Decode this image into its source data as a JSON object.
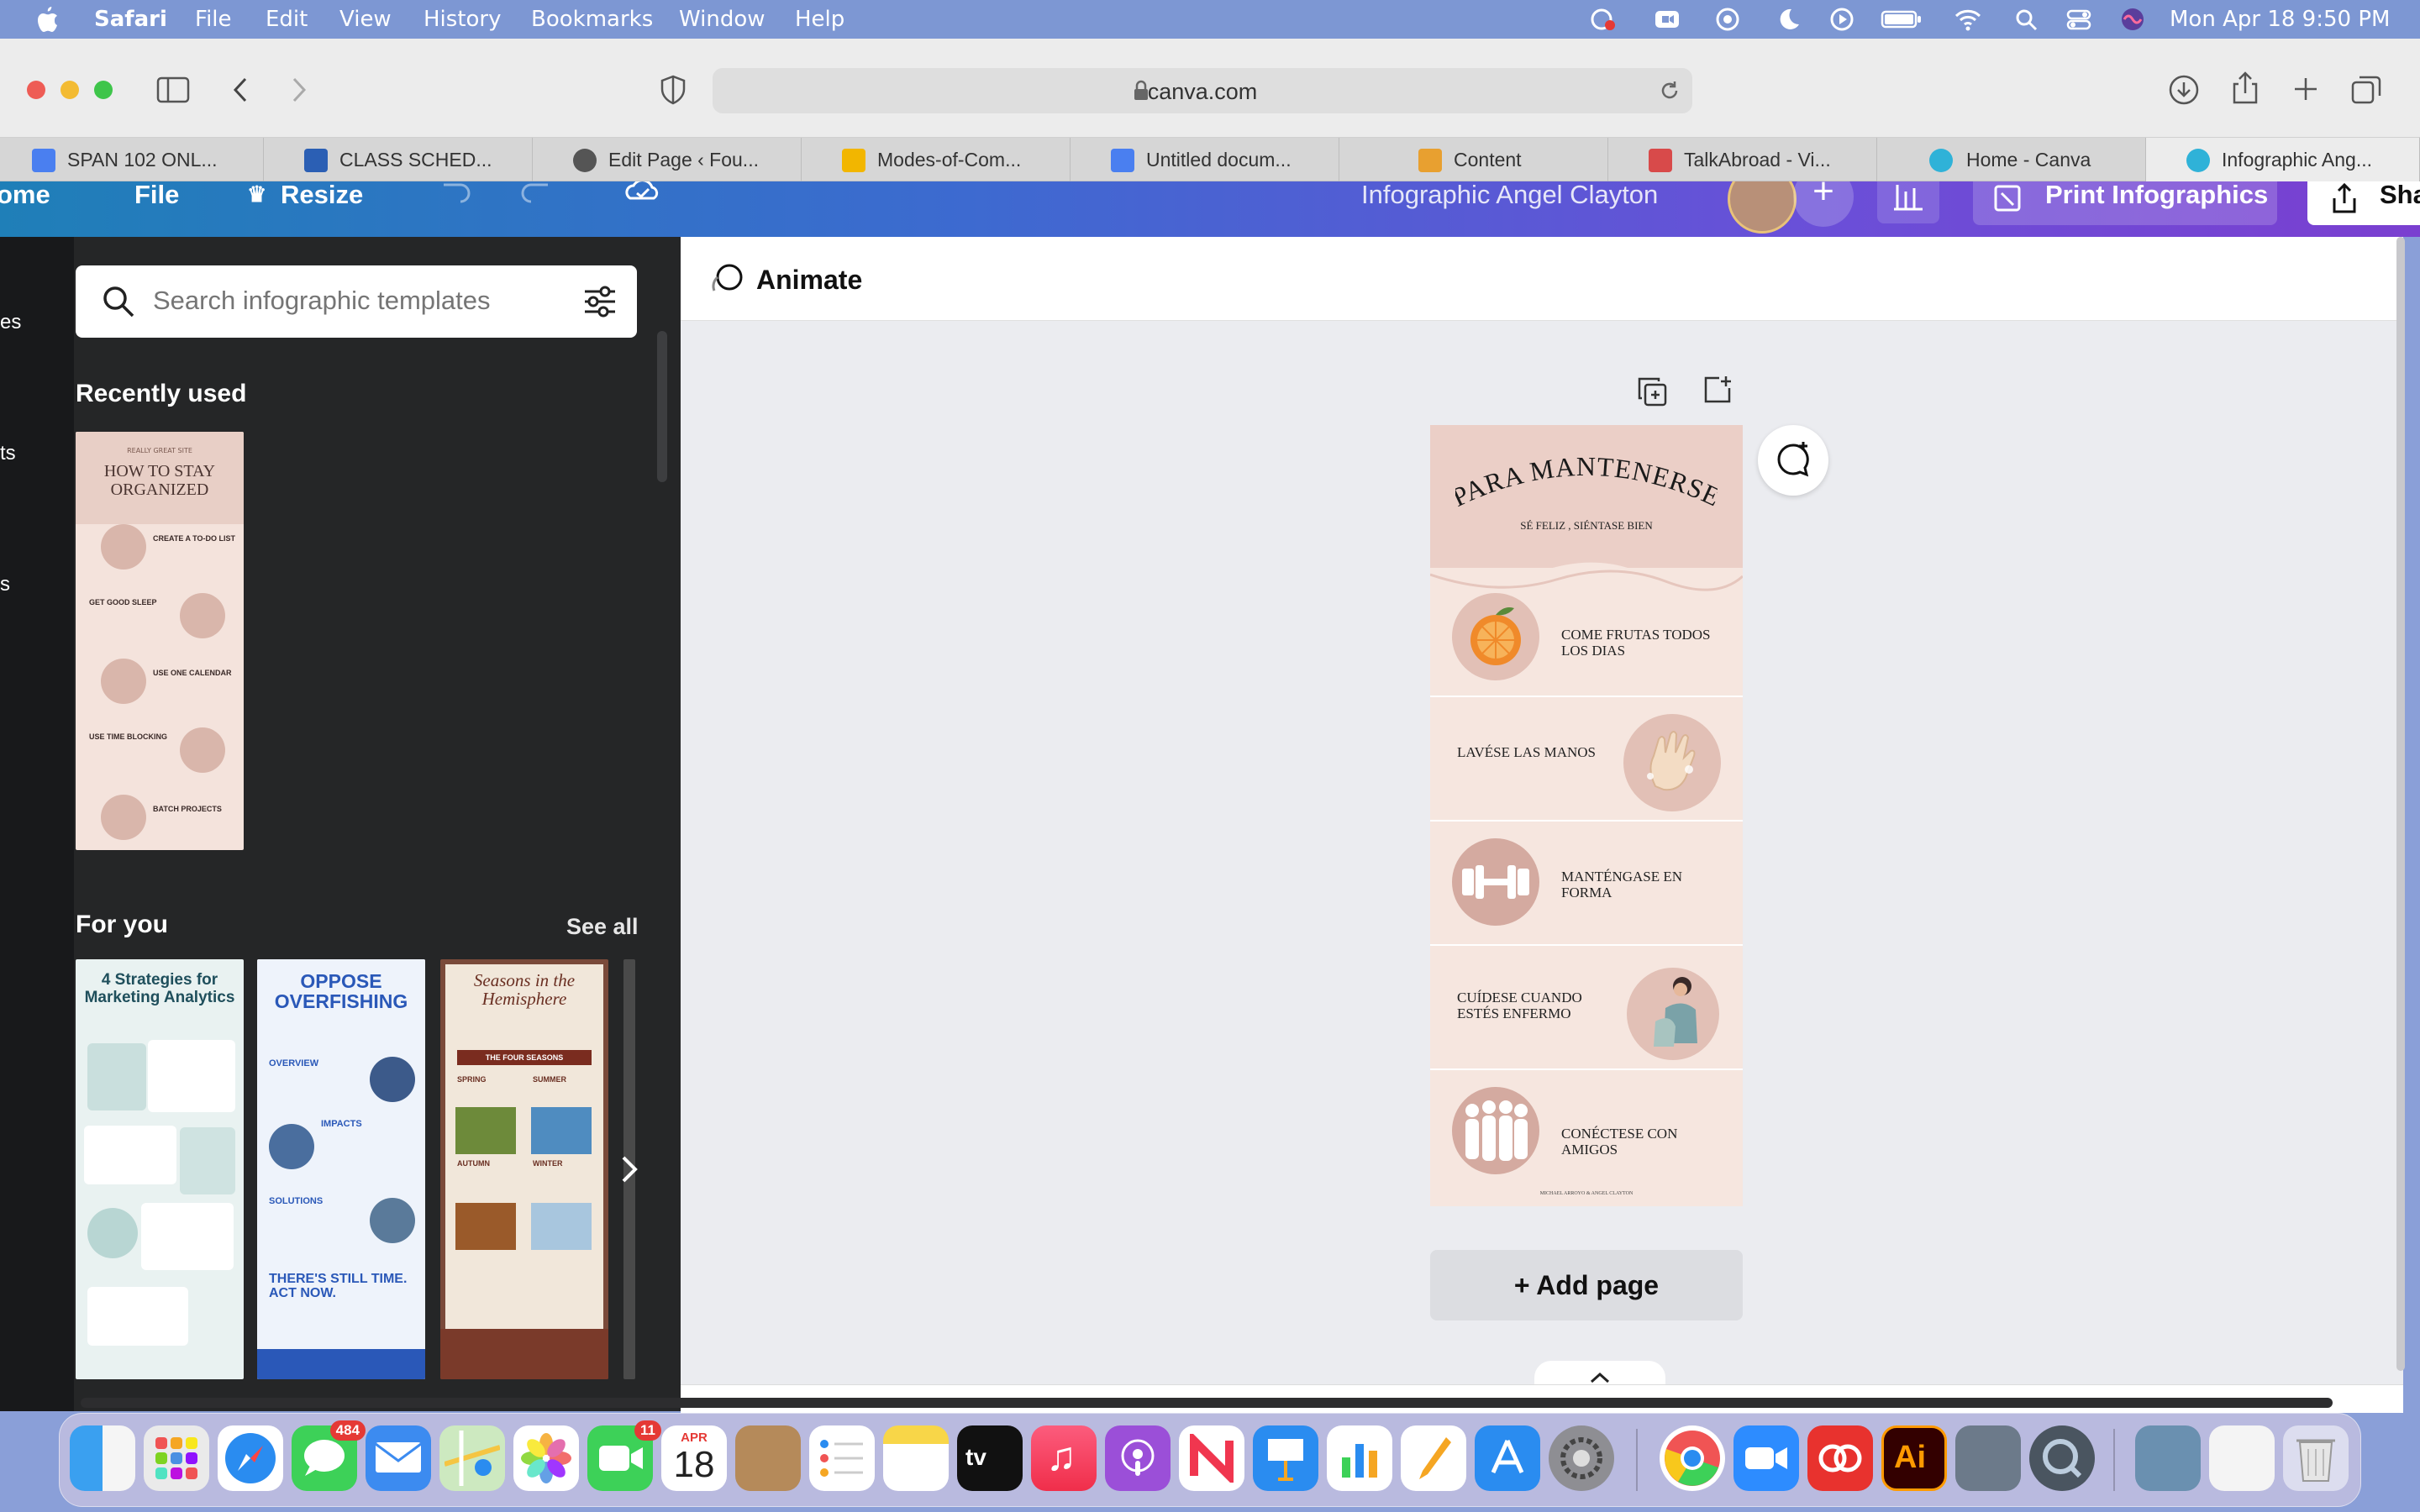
{
  "menubar": {
    "app": "Safari",
    "items": [
      "File",
      "Edit",
      "View",
      "History",
      "Bookmarks",
      "Window",
      "Help"
    ],
    "clock": "Mon Apr 18  9:50 PM"
  },
  "browser": {
    "url": "canva.com",
    "tabs": [
      {
        "label": "SPAN 102 ONL...",
        "color": "#4a7ff0"
      },
      {
        "label": "CLASS SCHED...",
        "color": "#2b5fb4"
      },
      {
        "label": "Edit Page ‹ Fou...",
        "color": "#555555"
      },
      {
        "label": "Modes-of-Com...",
        "color": "#f2b600"
      },
      {
        "label": "Untitled docum...",
        "color": "#4a7ff0"
      },
      {
        "label": "Content",
        "color": "#e8a030"
      },
      {
        "label": "TalkAbroad - Vi...",
        "color": "#d84a4a"
      },
      {
        "label": "Home - Canva",
        "color": "#2fb2d8"
      },
      {
        "label": "Infographic Ang...",
        "color": "#2fb2d8"
      }
    ]
  },
  "canva": {
    "header": {
      "home": "ome",
      "file": "File",
      "resize": "Resize",
      "title": "Infographic Angel Clayton",
      "print": "Print Infographics",
      "share": "Sha"
    },
    "sidebar_partial": [
      "es",
      "ts",
      "s"
    ],
    "search_placeholder": "Search infographic templates",
    "recent_title": "Recently used",
    "foryou_title": "For you",
    "see_all": "See all",
    "recent_template": {
      "kicker": "REALLY GREAT SITE",
      "title": "HOW TO STAY ORGANIZED",
      "items": [
        "CREATE A TO-DO LIST",
        "GET GOOD SLEEP",
        "USE ONE CALENDAR",
        "USE TIME BLOCKING",
        "BATCH PROJECTS"
      ]
    },
    "foryou_templates": [
      {
        "title": "4 Strategies for Marketing Analytics"
      },
      {
        "title": "OPPOSE OVERFISHING",
        "sub1": "OVERVIEW",
        "sub2": "IMPACTS",
        "sub3": "SOLUTIONS",
        "footer": "THERE'S STILL TIME. ACT NOW."
      },
      {
        "title": "Seasons in the Hemisphere",
        "band": "THE FOUR SEASONS",
        "s1": "SPRING",
        "s2": "SUMMER",
        "s3": "AUTUMN",
        "s4": "WINTER"
      }
    ],
    "animate": "Animate",
    "add_page": "+ Add page",
    "design": {
      "title": "PARA MANTENERSE",
      "subtitle": "SÉ FELIZ , SIÉNTASE BIEN",
      "rows": [
        "COME FRUTAS TODOS LOS DIAS",
        "LAVÉSE LAS MANOS",
        "MANTÉNGASE EN FORMA",
        "CUÍDESE CUANDO ESTÉS ENFERMO",
        "CONÉCTESE CON AMIGOS"
      ],
      "footer": "MICHAEL ARROYO & ANGEL CLAYTON"
    }
  },
  "dock": {
    "badges": {
      "messages": "484",
      "facetime": "11"
    },
    "calendar_month": "APR",
    "calendar_day": "18"
  },
  "colors": {
    "accent": "#8b3dff",
    "panel": "#252627",
    "page_bg": "#f6e6df"
  }
}
